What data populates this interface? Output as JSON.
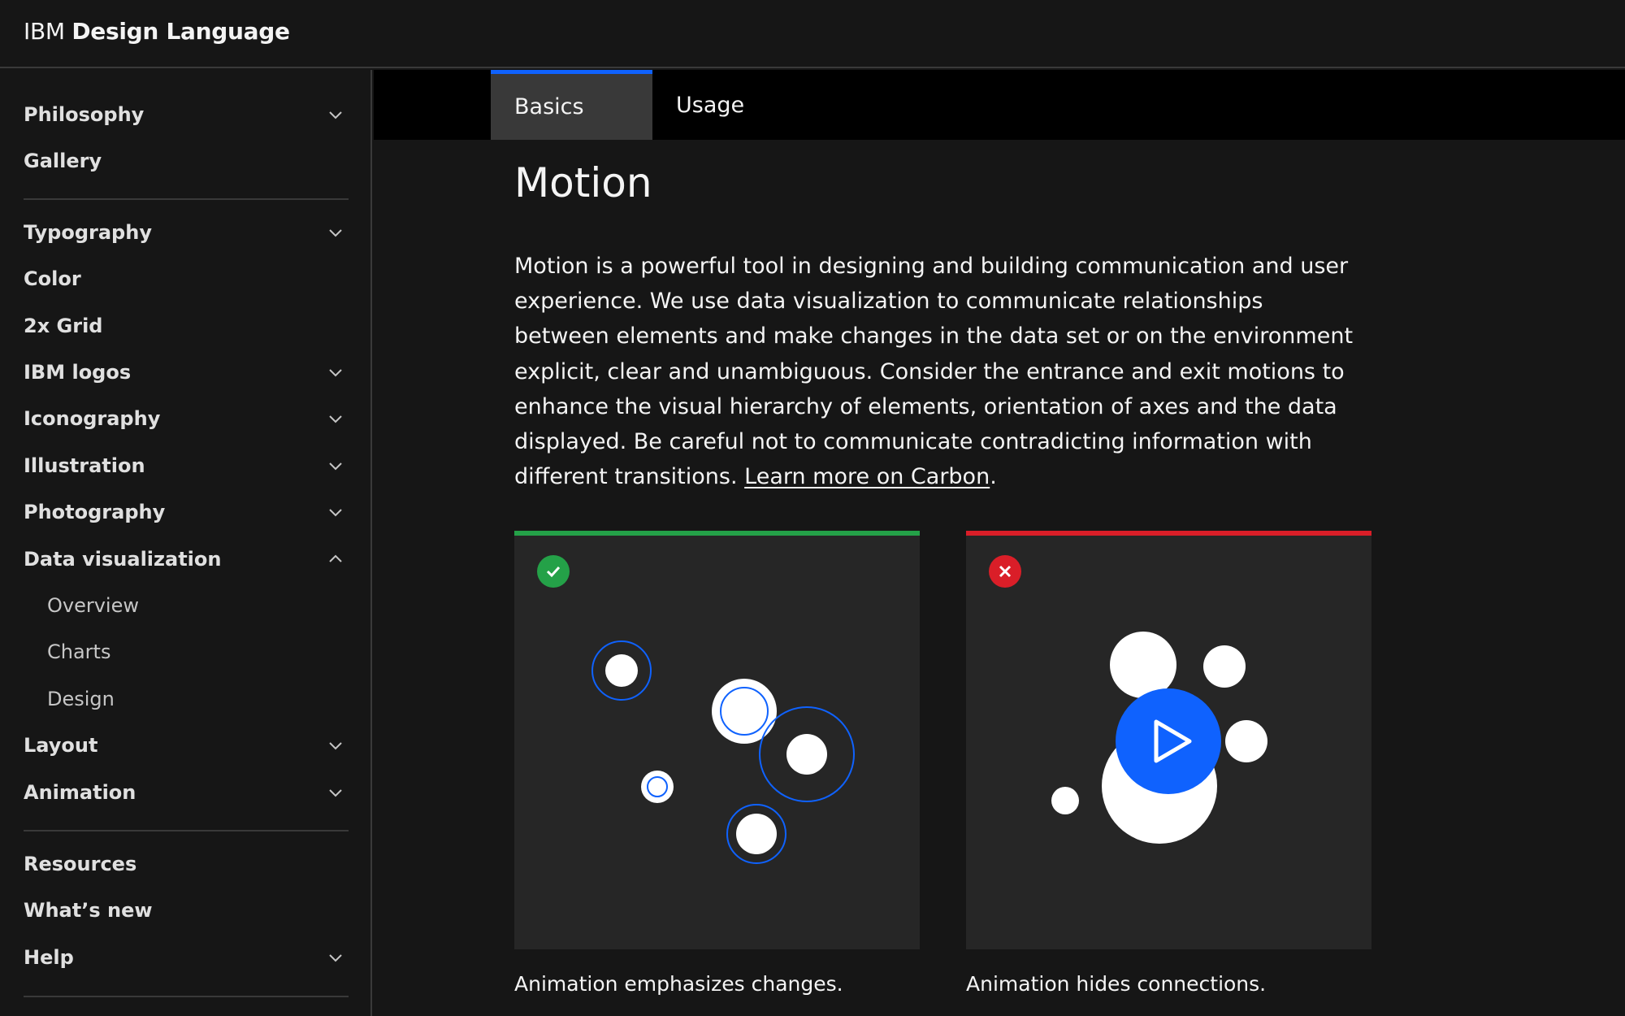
{
  "header": {
    "brand_light": "IBM",
    "brand_bold": "Design Language"
  },
  "sidebar": {
    "items": [
      {
        "label": "Philosophy",
        "chevron": "down"
      },
      {
        "label": "Gallery"
      },
      {
        "label": "Typography",
        "chevron": "down"
      },
      {
        "label": "Color"
      },
      {
        "label": "2x Grid"
      },
      {
        "label": "IBM logos",
        "chevron": "down"
      },
      {
        "label": "Iconography",
        "chevron": "down"
      },
      {
        "label": "Illustration",
        "chevron": "down"
      },
      {
        "label": "Photography",
        "chevron": "down"
      },
      {
        "label": "Data visualization",
        "chevron": "up"
      },
      {
        "label": "Overview"
      },
      {
        "label": "Charts"
      },
      {
        "label": "Design"
      },
      {
        "label": "Layout",
        "chevron": "down"
      },
      {
        "label": "Animation",
        "chevron": "down"
      },
      {
        "label": "Resources"
      },
      {
        "label": "What’s new"
      },
      {
        "label": "Help",
        "chevron": "down"
      }
    ]
  },
  "tabs": [
    {
      "label": "Basics",
      "active": true
    },
    {
      "label": "Usage",
      "active": false
    }
  ],
  "main": {
    "title": "Motion",
    "paragraph": "Motion is a powerful tool in designing and building communication and user experience. We use data visualization to communicate relationships between elements and make changes in the data set or on the environment explicit, clear and unambiguous. Consider the entrance and exit motions to enhance the visual hierarchy of elements, orientation of axes and the data displayed. Be careful not to communicate contradicting information with different transitions.",
    "link_text": "Learn more on Carbon",
    "trailing": "."
  },
  "cards": [
    {
      "status": "do",
      "icon": "checkmark-icon",
      "accent": "#24a148",
      "caption": "Animation emphasizes changes."
    },
    {
      "status": "dont",
      "icon": "close-icon",
      "accent": "#da1e28",
      "caption": "Animation hides connections."
    }
  ],
  "colors": {
    "primary": "#0f62fe",
    "background": "#161616",
    "card": "#262626"
  }
}
